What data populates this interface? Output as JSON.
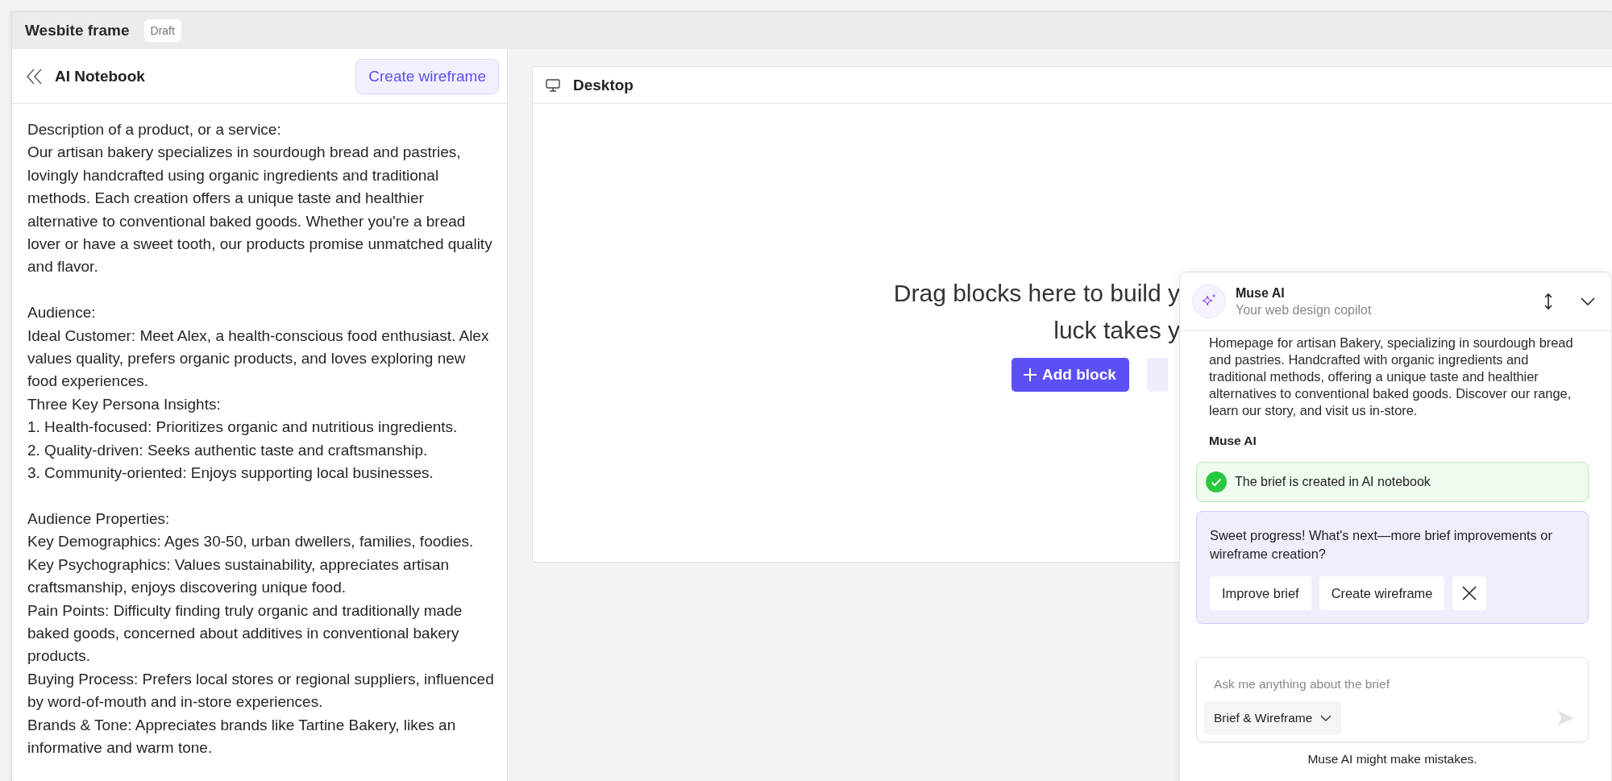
{
  "window": {
    "title": "Wesbite frame",
    "status_badge": "Draft"
  },
  "notebook": {
    "title": "AI Notebook",
    "action": "Create wireframe",
    "sections": [
      [
        "Description of a product, or a service:",
        "Our artisan bakery specializes in sourdough bread and pastries, lovingly handcrafted using organic ingredients and traditional methods. Each creation offers a unique taste and healthier alternative to conventional baked goods. Whether you're a bread lover or have a sweet tooth, our products promise unmatched quality and flavor."
      ],
      [
        "Audience:",
        "Ideal Customer: Meet Alex, a health-conscious food enthusiast. Alex values quality, prefers organic products, and loves exploring new food experiences.",
        "Three Key Persona Insights:",
        "1. Health-focused: Prioritizes organic and nutritious ingredients.",
        "2. Quality-driven: Seeks authentic taste and craftsmanship.",
        "3. Community-oriented: Enjoys supporting local businesses."
      ],
      [
        "Audience Properties:",
        "Key Demographics: Ages 30-50, urban dwellers, families, foodies.",
        "Key Psychographics: Values sustainability, appreciates artisan craftsmanship, enjoys discovering unique food.",
        "Pain Points: Difficulty finding truly organic and traditionally made baked goods, concerned about additives in conventional bakery products.",
        "Buying Process: Prefers local stores or regional suppliers, influenced by word-of-mouth and in-store experiences.",
        "Brands & Tone: Appreciates brands like Tartine Bakery, likes an informative and warm tone."
      ]
    ]
  },
  "canvas": {
    "title": "Desktop",
    "empty_lines": [
      "Drag blocks here to build y",
      "luck takes y"
    ],
    "add_button": "Add block"
  },
  "assistant": {
    "name": "Muse AI",
    "subtitle": "Your web design copilot",
    "messages": [
      {
        "kind": "text",
        "text": "Homepage for artisan Bakery, specializing in sourdough bread and pastries. Handcrafted with organic ingredients and traditional methods, offering a unique taste and healthier alternatives to conventional baked goods. Discover our range, learn our story, and visit us in-store."
      },
      {
        "kind": "sender",
        "text": "Muse AI"
      },
      {
        "kind": "success",
        "text": "The brief is created in AI notebook"
      },
      {
        "kind": "prompt",
        "text": "Sweet progress! What's next—more brief improvements or wireframe creation?",
        "actions": [
          "Improve brief",
          "Create wireframe"
        ]
      }
    ],
    "input": {
      "placeholder": "Ask me anything about the brief",
      "mode": "Brief & Wireframe"
    },
    "disclaimer": "Muse AI might make mistakes."
  }
}
